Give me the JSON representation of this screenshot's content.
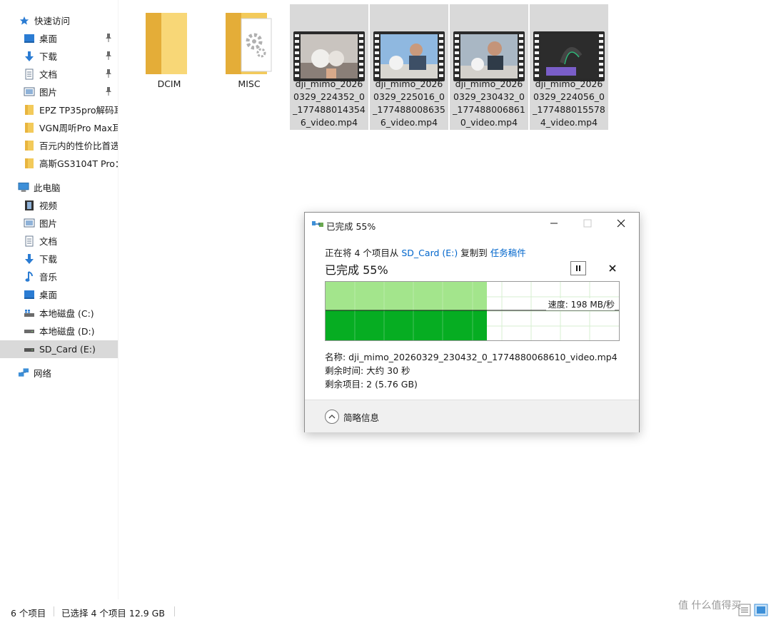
{
  "sidebar": {
    "quick_access": "快速访问",
    "quick_items": [
      {
        "label": "桌面"
      },
      {
        "label": "下载"
      },
      {
        "label": "文档"
      },
      {
        "label": "图片"
      },
      {
        "label": "EPZ TP35pro解码耳"
      },
      {
        "label": "VGN周听Pro Max耳"
      },
      {
        "label": "百元内的性价比首选"
      },
      {
        "label": "高斯GS3104T Pro："
      }
    ],
    "this_pc": "此电脑",
    "pc_items": [
      {
        "label": "视频"
      },
      {
        "label": "图片"
      },
      {
        "label": "文档"
      },
      {
        "label": "下载"
      },
      {
        "label": "音乐"
      },
      {
        "label": "桌面"
      },
      {
        "label": "本地磁盘 (C:)"
      },
      {
        "label": "本地磁盘 (D:)"
      },
      {
        "label": "SD_Card (E:)"
      }
    ],
    "network": "网络",
    "icons": [
      "star-icon",
      "desktop-icon",
      "download-icon",
      "document-icon",
      "picture-icon",
      "folder-icon",
      "computer-icon",
      "video-icon",
      "music-icon",
      "drive-icon",
      "network-icon",
      "pin-icon"
    ]
  },
  "files": [
    {
      "name": "DCIM",
      "type": "folder"
    },
    {
      "name": "MISC",
      "type": "folder-with-gear"
    },
    {
      "name": "dji_mimo_20260329_224352_0_1774880143546_video.mp4",
      "type": "video",
      "selected": true
    },
    {
      "name": "dji_mimo_20260329_225016_0_1774880086356_video.mp4",
      "type": "video",
      "selected": true
    },
    {
      "name": "dji_mimo_20260329_230432_0_1774880068610_video.mp4",
      "type": "video",
      "selected": true
    },
    {
      "name": "dji_mimo_20260329_224056_0_1774880155784_video.mp4",
      "type": "video",
      "selected": true
    }
  ],
  "statusbar": {
    "count": "6 个项目",
    "selection": "已选择 4 个项目 12.9 GB"
  },
  "dialog": {
    "title": "已完成 55%",
    "copy_prefix": "正在将 4 个项目从 ",
    "source": "SD_Card (E:)",
    "copy_mid": " 复制到 ",
    "destination": "任务稿件",
    "percent_text": "已完成 55%",
    "progress": 0.55,
    "speed": "速度: 198 MB/秒",
    "name_line": "名称: dji_mimo_20260329_230432_0_1774880068610_video.mp4",
    "time_line": "剩余时间: 大约 30 秒",
    "items_line": "剩余项目: 2 (5.76 GB)",
    "more_info": "简略信息",
    "colors": {
      "progress_light": "#a3e58c",
      "progress_dark": "#06ad22",
      "link": "#0066cc"
    }
  },
  "watermark": "值 什么值得买"
}
